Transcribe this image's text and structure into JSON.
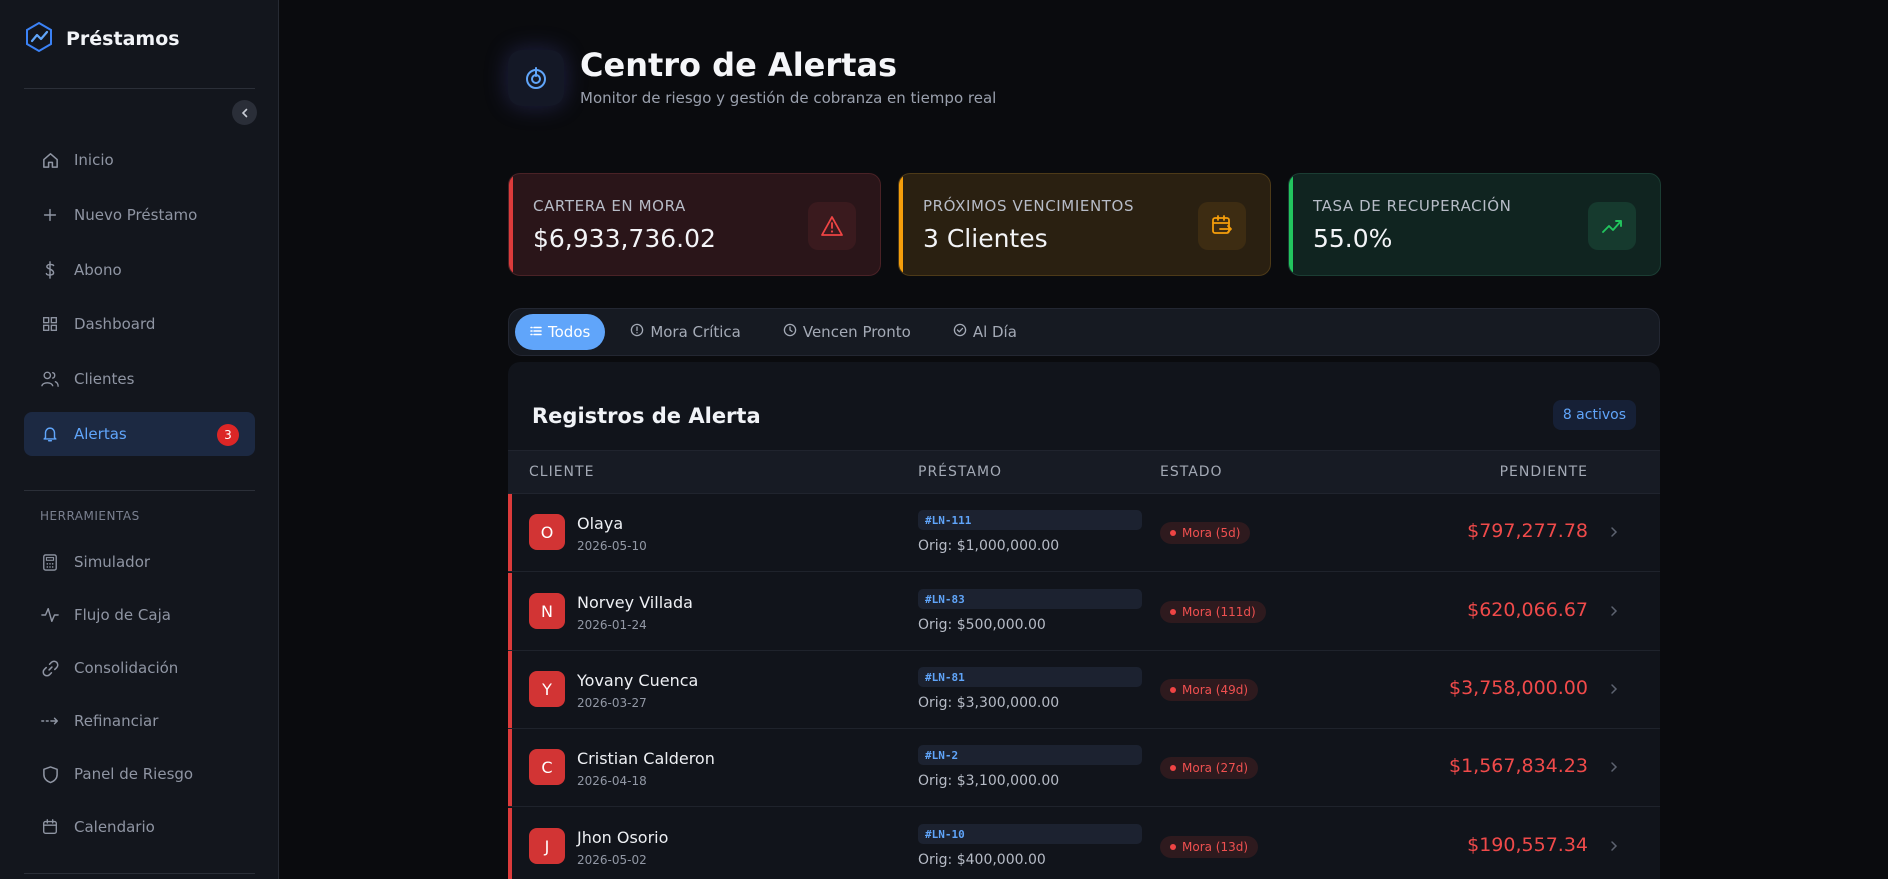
{
  "app": {
    "title": "Préstamos"
  },
  "sidebar": {
    "items": [
      {
        "label": "Inicio",
        "icon": "home-icon"
      },
      {
        "label": "Nuevo Préstamo",
        "icon": "plus-icon"
      },
      {
        "label": "Abono",
        "icon": "dollar-icon"
      },
      {
        "label": "Dashboard",
        "icon": "grid-icon"
      },
      {
        "label": "Clientes",
        "icon": "users-icon"
      },
      {
        "label": "Alertas",
        "icon": "bell-icon",
        "badge": "3",
        "active": true
      }
    ],
    "tools_label": "HERRAMIENTAS",
    "tools": [
      {
        "label": "Simulador",
        "icon": "calculator-icon"
      },
      {
        "label": "Flujo de Caja",
        "icon": "activity-icon"
      },
      {
        "label": "Consolidación",
        "icon": "link-icon"
      },
      {
        "label": "Refinanciar",
        "icon": "arrows-icon"
      },
      {
        "label": "Panel de Riesgo",
        "icon": "shield-icon"
      },
      {
        "label": "Calendario",
        "icon": "calendar-icon"
      }
    ]
  },
  "header": {
    "title": "Centro de Alertas",
    "subtitle": "Monitor de riesgo y gestión de cobranza en tiempo real"
  },
  "stats": [
    {
      "label": "CARTERA EN MORA",
      "value": "$6,933,736.02",
      "icon": "warning-icon",
      "color": "#dc3b3b"
    },
    {
      "label": "PRÓXIMOS VENCIMIENTOS",
      "value": "3 Clientes",
      "icon": "calendar-arrow-icon",
      "color": "#f59e0b"
    },
    {
      "label": "TASA DE RECUPERACIÓN",
      "value": "55.0%",
      "icon": "trending-up-icon",
      "color": "#22c55e"
    }
  ],
  "tabs": [
    {
      "label": "Todos",
      "icon": "list-icon",
      "active": true
    },
    {
      "label": "Mora Crítica",
      "icon": "alert-circle-icon"
    },
    {
      "label": "Vencen Pronto",
      "icon": "clock-icon"
    },
    {
      "label": "Al Día",
      "icon": "check-circle-icon"
    }
  ],
  "table": {
    "title": "Registros de Alerta",
    "active_count": "8 activos",
    "columns": [
      "CLIENTE",
      "PRÉSTAMO",
      "ESTADO",
      "PENDIENTE"
    ],
    "rows": [
      {
        "initial": "O",
        "name": "Olaya",
        "date": "2026-05-10",
        "code": "#LN-111",
        "orig": "Orig: $1,000,000.00",
        "status": "Mora (5d)",
        "amount": "$797,277.78"
      },
      {
        "initial": "N",
        "name": "Norvey Villada",
        "date": "2026-01-24",
        "code": "#LN-83",
        "orig": "Orig: $500,000.00",
        "status": "Mora (111d)",
        "amount": "$620,066.67"
      },
      {
        "initial": "Y",
        "name": "Yovany Cuenca",
        "date": "2026-03-27",
        "code": "#LN-81",
        "orig": "Orig: $3,300,000.00",
        "status": "Mora (49d)",
        "amount": "$3,758,000.00"
      },
      {
        "initial": "C",
        "name": "Cristian Calderon",
        "date": "2026-04-18",
        "code": "#LN-2",
        "orig": "Orig: $3,100,000.00",
        "status": "Mora (27d)",
        "amount": "$1,567,834.23"
      },
      {
        "initial": "J",
        "name": "Jhon Osorio",
        "date": "2026-05-02",
        "code": "#LN-10",
        "orig": "Orig: $400,000.00",
        "status": "Mora (13d)",
        "amount": "$190,557.34"
      }
    ]
  },
  "colors": {
    "accent": "#60a5fa",
    "danger": "#ef4444",
    "warning": "#f59e0b",
    "success": "#22c55e"
  }
}
